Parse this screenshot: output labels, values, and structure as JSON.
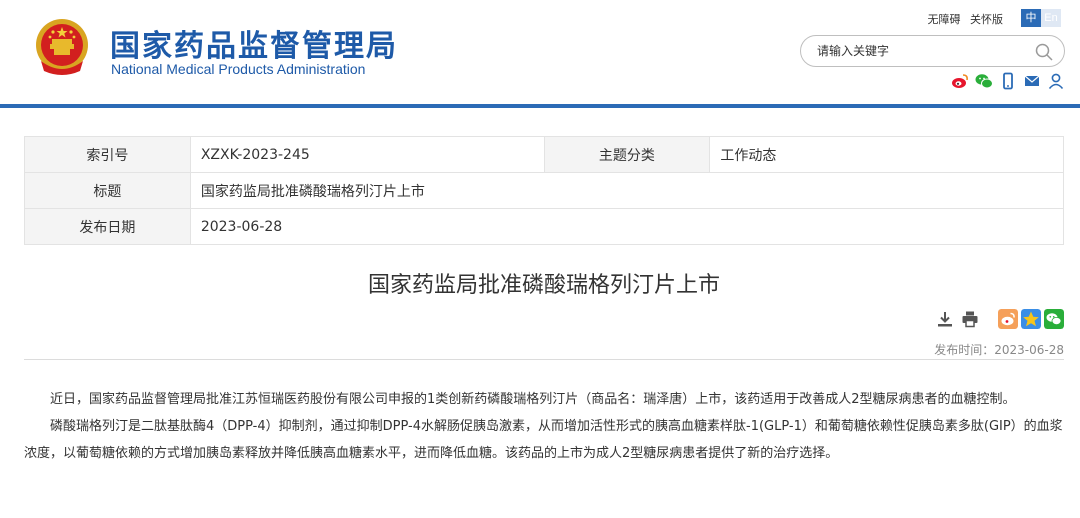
{
  "header": {
    "site_name_cn": "国家药品监督管理局",
    "site_name_en": "National Medical Products Administration",
    "top_links": [
      "无障碍",
      "关怀版"
    ],
    "lang_cn": "中",
    "lang_en": "En",
    "search_placeholder": "请输入关键字",
    "brand_color": "#1e5aa8",
    "social_icons": [
      "weibo-icon",
      "wechat-icon",
      "mobile-icon",
      "mail-icon",
      "user-icon"
    ]
  },
  "info_table": {
    "index_label": "索引号",
    "index_value": "XZXK-2023-245",
    "category_label": "主题分类",
    "category_value": "工作动态",
    "title_label": "标题",
    "title_value": "国家药监局批准磷酸瑞格列汀片上市",
    "date_label": "发布日期",
    "date_value": "2023-06-28"
  },
  "article": {
    "title": "国家药监局批准磷酸瑞格列汀片上市",
    "tool_icons": [
      "download-icon",
      "print-icon"
    ],
    "share_icons": [
      "weibo-share-icon",
      "qzone-share-icon",
      "wechat-share-icon"
    ],
    "published_label": "发布时间：",
    "published_value": "2023-06-28",
    "paragraphs": [
      "近日，国家药品监督管理局批准江苏恒瑞医药股份有限公司申报的1类创新药磷酸瑞格列汀片（商品名：瑞泽唐）上市，该药适用于改善成人2型糖尿病患者的血糖控制。",
      "磷酸瑞格列汀是二肽基肽酶4（DPP-4）抑制剂，通过抑制DPP-4水解肠促胰岛激素，从而增加活性形式的胰高血糖素样肽-1(GLP-1）和葡萄糖依赖性促胰岛素多肽(GIP）的血浆浓度，以葡萄糖依赖的方式增加胰岛素释放并降低胰高血糖素水平，进而降低血糖。该药品的上市为成人2型糖尿病患者提供了新的治疗选择。"
    ]
  }
}
